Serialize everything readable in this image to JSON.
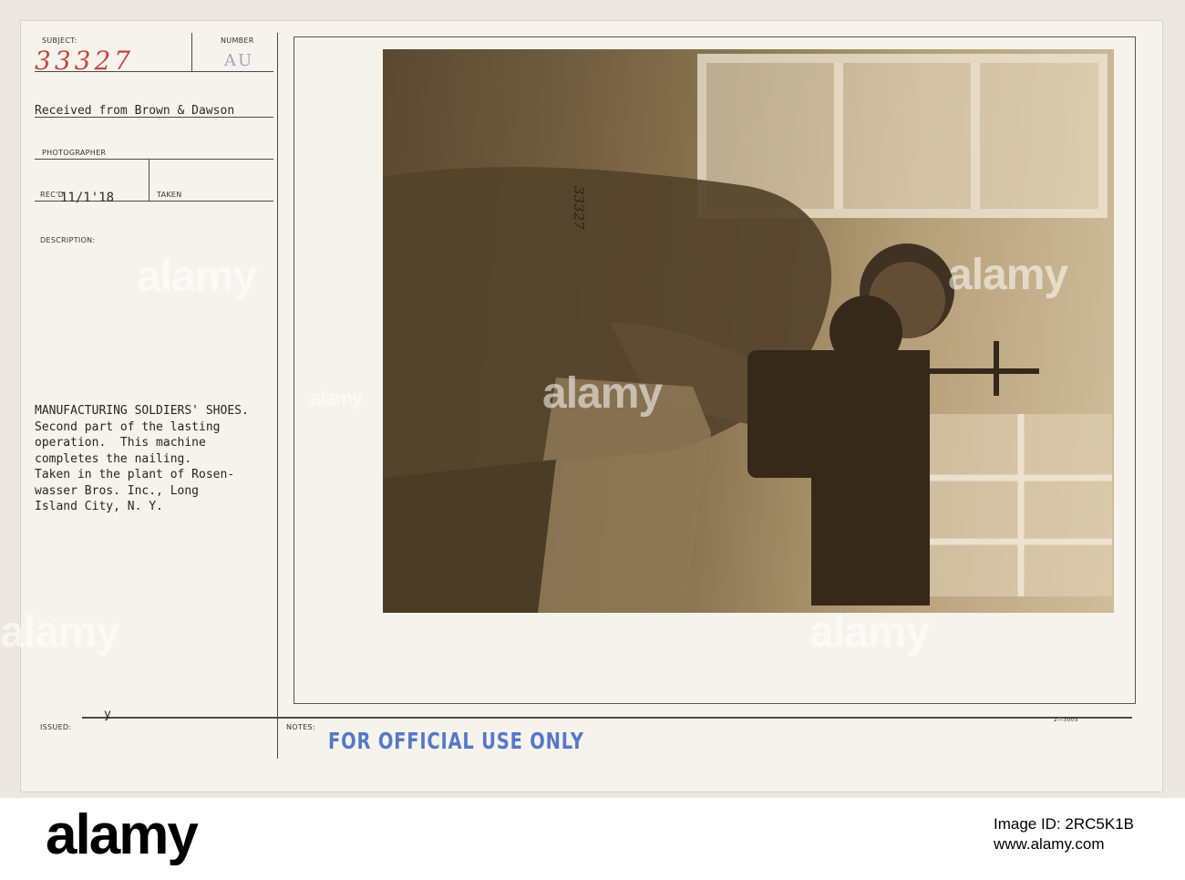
{
  "card": {
    "labels": {
      "subject": "SUBJECT:",
      "number": "NUMBER",
      "photographer": "PHOTOGRAPHER",
      "recd": "REC'D",
      "taken": "TAKEN",
      "description": "DESCRIPTION:",
      "issued": "ISSUED:",
      "notes": "NOTES:"
    },
    "subject_number": "33327",
    "number_stamp": "AU",
    "received_from": "Received from Brown & Dawson",
    "recd_date": "11/1'18",
    "issued_mark": "y",
    "form_code": "2—3005",
    "description_lines": [
      "MANUFACTURING SOLDIERS' SHOES.",
      "Second part of the lasting",
      "operation.  This machine",
      "completes the nailing.",
      "Taken in the plant of Rosen-",
      "wasser Bros. Inc., Long",
      "Island City, N. Y."
    ],
    "photo_annotation": "33327",
    "official_stamp": "FOR OFFICIAL USE ONLY"
  },
  "watermark": "alamy",
  "footer": {
    "logo": "alamy",
    "image_id_line": "Image ID: 2RC5K1B",
    "site": "www.alamy.com"
  },
  "colors": {
    "handwriting": "#c6463f",
    "stamp_blue": "#5578c8",
    "card": "#f6f3ec"
  }
}
